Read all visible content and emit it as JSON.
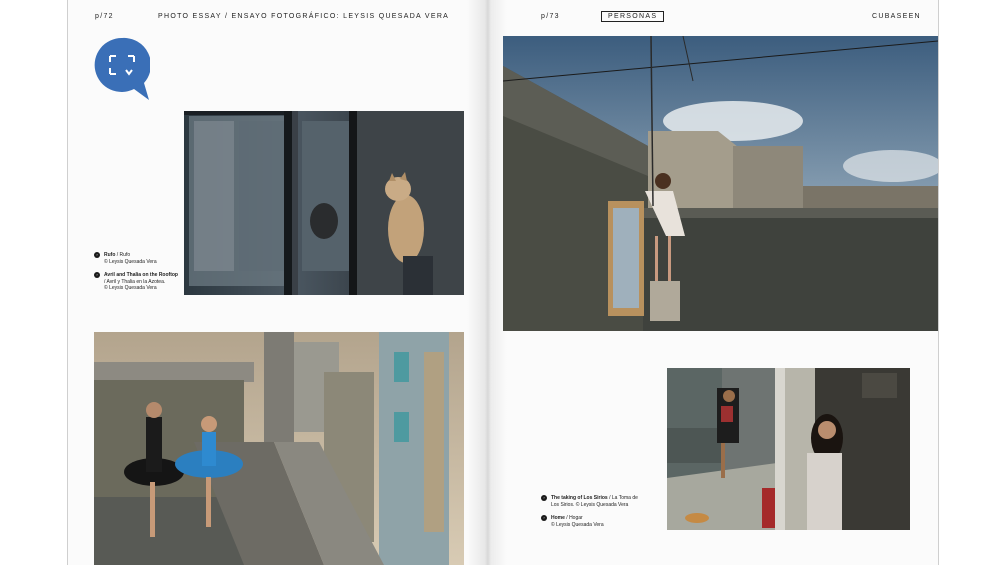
{
  "header": {
    "left_page_number": "p/72",
    "essay_title": "PHOTO ESSAY / ENSAYO FOTOGRÁFICO: LEYSIS QUESADA VERA",
    "right_page_number": "p/73",
    "section_label": "PERSONAS",
    "brand": "CUBASEEN"
  },
  "logo": {
    "icon": "camera-frame-icon",
    "color": "#3a6fb7"
  },
  "captions": [
    {
      "title": "Rufo",
      "translation": " / Rufo",
      "credit": "© Leysis Quesada Vera"
    },
    {
      "title": "Avril and Thalia on the Rooftop",
      "translation": " / Avril y Thalia en la Azotea.",
      "credit": "© Leysis Quesada Vera"
    },
    {
      "title": "The taking of Los Sirios",
      "translation": " / La Toma de Los Sirios.",
      "credit": "© Leysis Quesada Vera"
    },
    {
      "title": "Home",
      "translation": " / Hogar",
      "credit": "© Leysis Quesada Vera"
    }
  ]
}
